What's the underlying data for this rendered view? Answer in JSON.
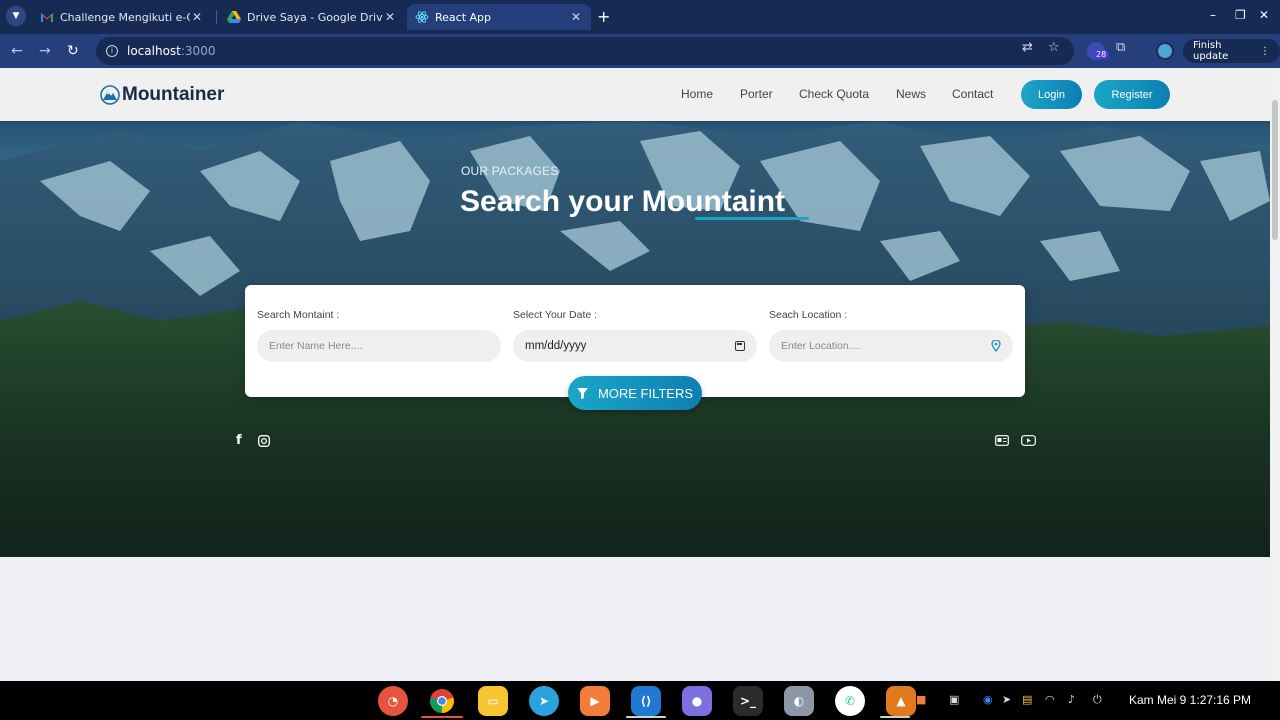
{
  "browser": {
    "tabs": [
      {
        "title": "Challenge Mengikuti e-Co",
        "favicon": "gmail-icon"
      },
      {
        "title": "Drive Saya - Google Drive",
        "favicon": "google-drive-icon"
      },
      {
        "title": "React App",
        "favicon": "react-icon",
        "active": true
      }
    ],
    "url_host": "localhost",
    "url_port": ":3000",
    "extension_badge": "28",
    "finish_update_label": "Finish update"
  },
  "site": {
    "brand": "Mountainer",
    "nav_links": [
      "Home",
      "Porter",
      "Check Quota",
      "News",
      "Contact"
    ],
    "login_label": "Login",
    "register_label": "Register",
    "hero": {
      "subtitle": "OUR PACKAGES",
      "title_prefix": "Search your ",
      "title_highlight": "Mountaint"
    },
    "search": {
      "name_label": "Search Montaint :",
      "name_placeholder": "Enter Name Here....",
      "date_label": "Select Your Date :",
      "date_value": "mm/dd/yyyy",
      "location_label": "Seach Location :",
      "location_placeholder": "Enter Location...."
    },
    "more_filters_label": "MORE FILTERS"
  },
  "taskbar": {
    "clock": "Kam Mei 9   1:27:16 PM"
  },
  "colors": {
    "accent": "#1aa6c8",
    "accent_dark": "#0e7fb3",
    "brand_text": "#172a46",
    "chrome_dark": "#172a54",
    "chrome_mid": "#253f7d"
  }
}
